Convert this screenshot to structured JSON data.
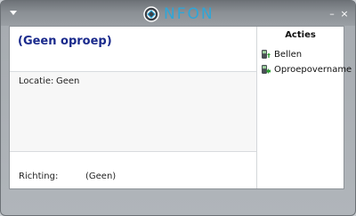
{
  "window": {
    "brand": "NFON",
    "minimize_glyph": "–",
    "close_glyph": "×",
    "brand_color": "#2ea6d8"
  },
  "call": {
    "title": "(Geen oproep)",
    "location_label": "Locatie:",
    "location_value": "Geen",
    "direction_label": "Richting:",
    "direction_value": "(Geen)"
  },
  "actions": {
    "title": "Acties",
    "items": [
      {
        "label": "Bellen",
        "icon": "phone-call-icon"
      },
      {
        "label": "Oproepovername",
        "icon": "call-pickup-icon"
      }
    ]
  }
}
